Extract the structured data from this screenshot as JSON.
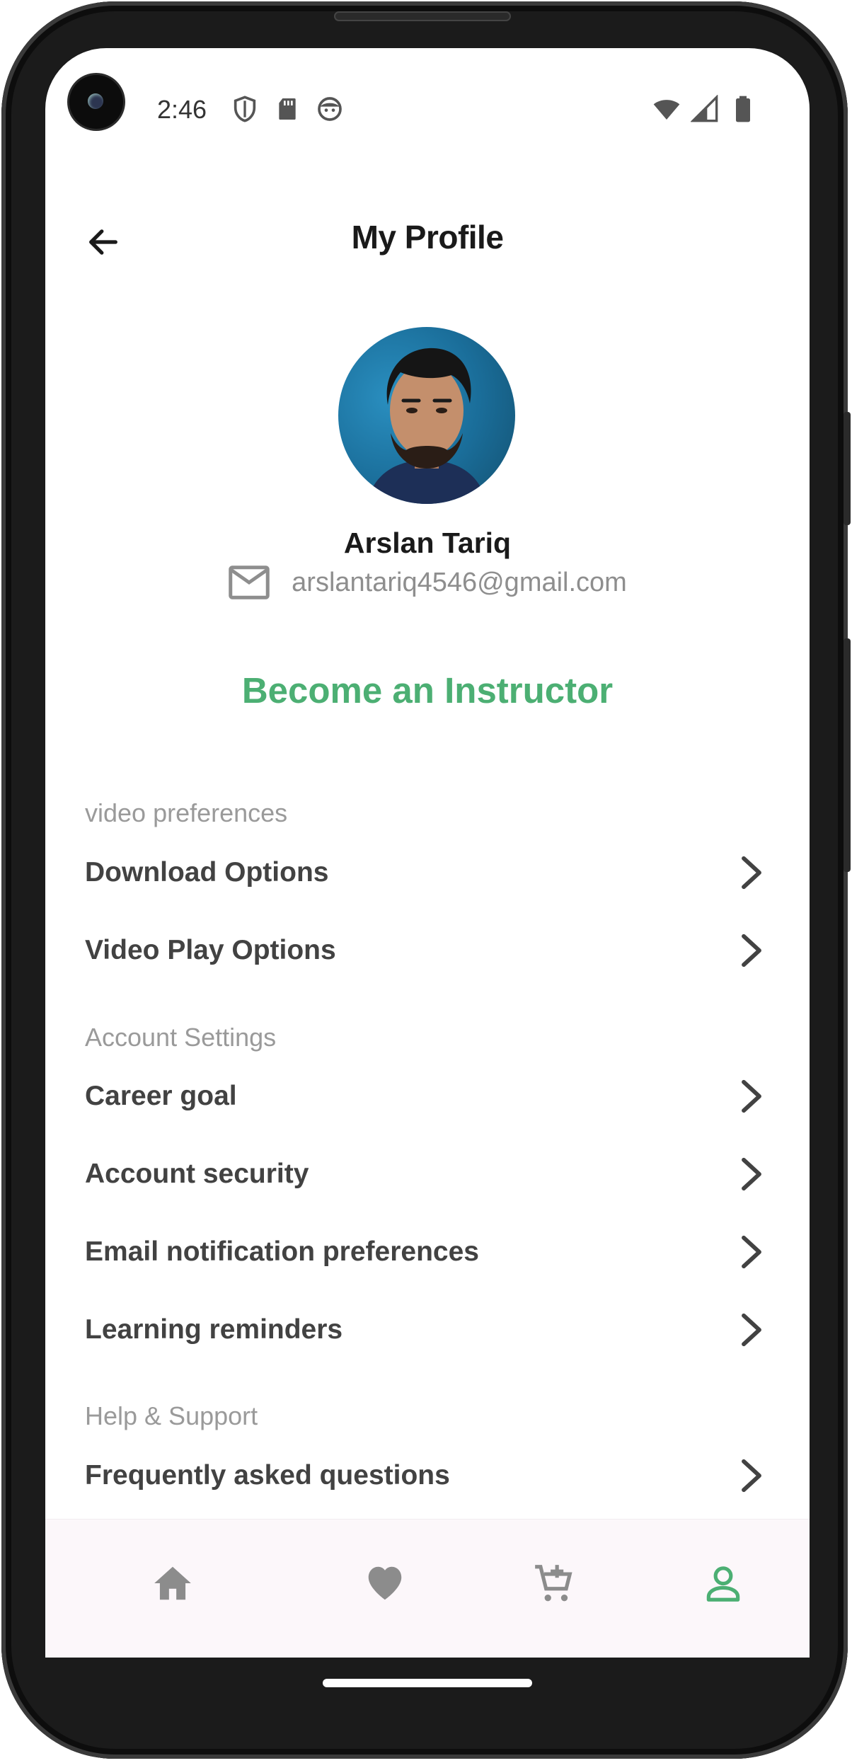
{
  "status_bar": {
    "time": "2:46",
    "left_icons": [
      "shield-icon",
      "sd-card-icon",
      "face-icon"
    ],
    "right_icons": [
      "wifi-icon",
      "signal-icon",
      "battery-icon"
    ]
  },
  "header": {
    "back_icon": "arrow-left-icon",
    "title": "My Profile"
  },
  "profile": {
    "name": "Arslan Tariq",
    "email": "arslantariq4546@gmail.com",
    "email_icon": "mail-icon"
  },
  "become_instructor": "Become an Instructor",
  "sections": {
    "video_preferences": {
      "title": "video preferences",
      "items": [
        "Download Options",
        "Video Play Options"
      ]
    },
    "account_settings": {
      "title": "Account Settings",
      "items": [
        "Career goal",
        "Account security",
        "Email notification preferences",
        "Learning reminders"
      ]
    },
    "help_support": {
      "title": "Help & Support",
      "items": [
        "Frequently asked questions"
      ]
    }
  },
  "bottom_nav": {
    "items": [
      {
        "icon": "home-icon",
        "active": false
      },
      {
        "icon": "heart-icon",
        "active": false
      },
      {
        "icon": "cart-add-icon",
        "active": false
      },
      {
        "icon": "person-icon",
        "active": true
      }
    ]
  },
  "colors": {
    "accent": "#4caf73",
    "title_text": "#1a1a1a",
    "item_text": "#424242",
    "muted_text": "#9a9a9a",
    "nav_bg": "#fcf7fa",
    "nav_icon_inactive": "#8c8c8c"
  }
}
